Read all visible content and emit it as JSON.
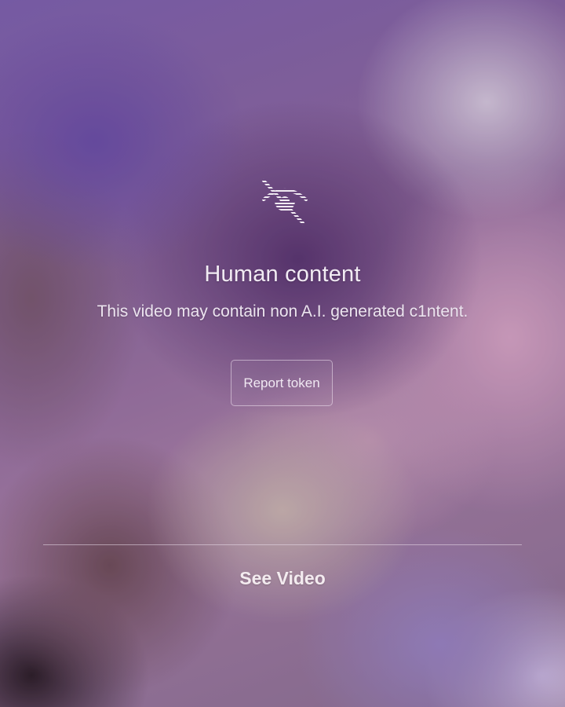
{
  "notice": {
    "icon": "eye-slash-icon",
    "title": "Human content",
    "message": "This video may contain non A.I. generated c1ntent."
  },
  "actions": {
    "report_label": "Report token",
    "see_video_label": "See Video"
  },
  "colors": {
    "text": "#f1ebf3",
    "button_border": "#ece0ee",
    "divider": "#ebdeeb"
  }
}
